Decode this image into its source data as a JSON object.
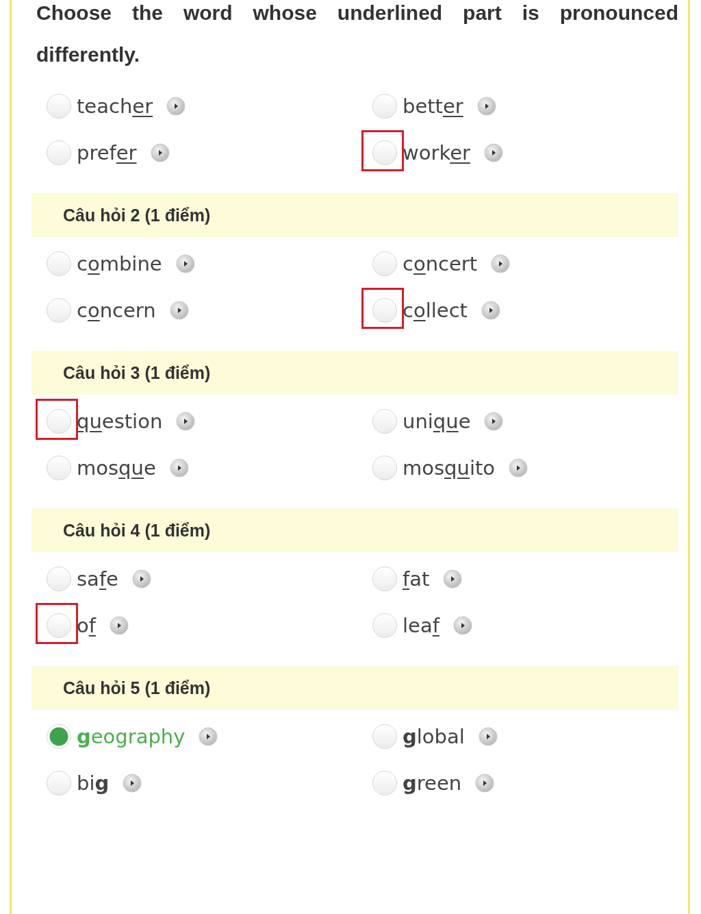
{
  "instruction": "Choose the word whose underlined part is pronounced differently.",
  "questions": [
    {
      "underlined": true,
      "options": [
        {
          "pre": "teach",
          "mark": "er",
          "selected": false,
          "highlighted": false
        },
        {
          "pre": "bett",
          "mark": "er",
          "selected": false,
          "highlighted": false
        },
        {
          "pre": "pref",
          "mark": "er",
          "selected": false,
          "highlighted": false
        },
        {
          "pre": "work",
          "mark": "er",
          "selected": false,
          "highlighted": true
        }
      ]
    },
    {
      "title": "Câu hỏi 2 (1 điểm)",
      "underlined": true,
      "options": [
        {
          "pre": "c",
          "mark": "o",
          "post": "mbine",
          "selected": false,
          "highlighted": false
        },
        {
          "pre": "c",
          "mark": "o",
          "post": "ncert",
          "selected": false,
          "highlighted": false
        },
        {
          "pre": "c",
          "mark": "o",
          "post": "ncern",
          "selected": false,
          "highlighted": false
        },
        {
          "pre": "c",
          "mark": "o",
          "post": "llect",
          "selected": false,
          "highlighted": true
        }
      ]
    },
    {
      "title": "Câu hỏi 3 (1 điểm)",
      "underlined": true,
      "options": [
        {
          "mark": "qu",
          "post": "estion",
          "selected": false,
          "highlighted": true
        },
        {
          "pre": "uni",
          "mark": "qu",
          "post": "e",
          "selected": false,
          "highlighted": false
        },
        {
          "pre": "mos",
          "mark": "qu",
          "post": "e",
          "selected": false,
          "highlighted": false
        },
        {
          "pre": "mos",
          "mark": "qu",
          "post": "ito",
          "selected": false,
          "highlighted": false
        }
      ]
    },
    {
      "title": "Câu hỏi 4 (1 điểm)",
      "underlined": true,
      "options": [
        {
          "pre": "sa",
          "mark": "f",
          "post": "e",
          "selected": false,
          "highlighted": false
        },
        {
          "mark": "f",
          "post": "at",
          "selected": false,
          "highlighted": false
        },
        {
          "pre": "o",
          "mark": "f",
          "selected": false,
          "highlighted": true
        },
        {
          "pre": "lea",
          "mark": "f",
          "selected": false,
          "highlighted": false
        }
      ]
    },
    {
      "title": "Câu hỏi 5 (1 điểm)",
      "underlined": false,
      "options": [
        {
          "mark": "g",
          "post": "eography",
          "selected": true,
          "highlighted": false
        },
        {
          "mark": "g",
          "post": "lobal",
          "selected": false,
          "highlighted": false
        },
        {
          "pre": "bi",
          "mark": "g",
          "selected": false,
          "highlighted": false
        },
        {
          "mark": "g",
          "post": "reen",
          "selected": false,
          "highlighted": false
        }
      ]
    }
  ]
}
